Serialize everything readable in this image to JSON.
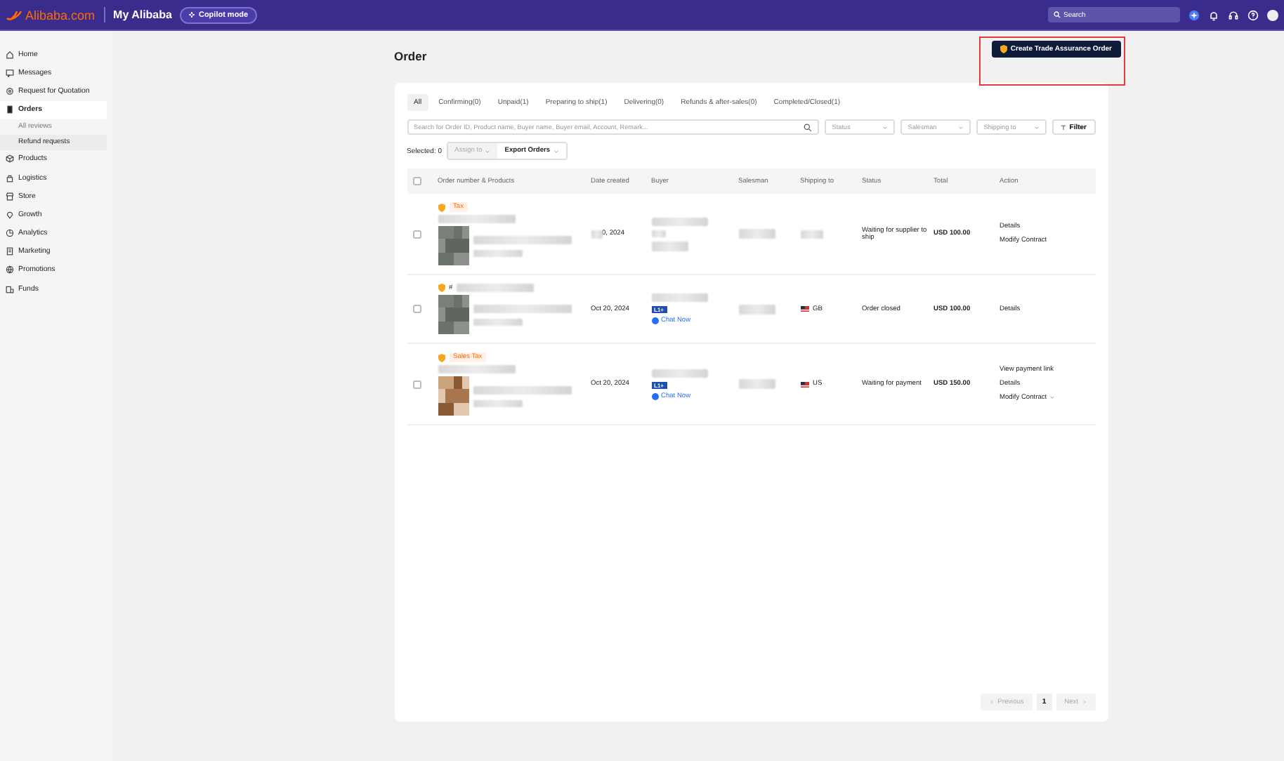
{
  "topbar": {
    "logo": "Alibaba.com",
    "title": "My Alibaba",
    "copilot": "Copilot mode",
    "search_placeholder": "Search"
  },
  "sidebar": {
    "items": [
      {
        "label": "Home",
        "selected": false
      },
      {
        "label": "Messages",
        "selected": false
      },
      {
        "label": "Request for Quotation",
        "selected": false
      },
      {
        "label": "Orders",
        "selected": true,
        "children": [
          {
            "label": "All reviews",
            "selected": false
          },
          {
            "label": "Refund requests",
            "selected": true
          }
        ]
      },
      {
        "label": "Products",
        "selected": false
      },
      {
        "label": "Logistics",
        "selected": false
      },
      {
        "label": "Store",
        "selected": false
      },
      {
        "label": "Growth",
        "selected": false
      },
      {
        "label": "Analytics",
        "selected": false
      },
      {
        "label": "Marketing",
        "selected": false
      },
      {
        "label": "Promotions",
        "selected": false
      },
      {
        "label": "Funds",
        "selected": false
      }
    ]
  },
  "page": {
    "title": "Order",
    "create_button": {
      "label": "Create Trade Assurance Order",
      "highlighted": true
    }
  },
  "tabs": [
    {
      "label": "All",
      "selected": true
    },
    {
      "label": "Confirming(0)",
      "selected": false
    },
    {
      "label": "Unpaid(1)",
      "selected": false
    },
    {
      "label": "Preparing to ship(1)",
      "selected": false
    },
    {
      "label": "Delivering(0)",
      "selected": false
    },
    {
      "label": "Refunds & after-sales(0)",
      "selected": false
    },
    {
      "label": "Completed/Closed(1)",
      "selected": false
    }
  ],
  "search": {
    "placeholder": "Search for Order ID, Product name, Buyer name, Buyer email, Account, Remark..."
  },
  "dropdowns": [
    "Status",
    "Salesman",
    "Shipping to"
  ],
  "filter_button": "Filter",
  "selection": {
    "label": "Selected: 0",
    "assign": {
      "label": "Assign to",
      "disabled": true
    },
    "export": "Export Orders"
  },
  "table": {
    "all_checked": false,
    "columns": [
      "Order number & Products",
      "Date created",
      "Buyer",
      "Salesman",
      "Shipping to",
      "Status",
      "Total",
      "Action"
    ],
    "rows": [
      {
        "checked": false,
        "tag": "Tax",
        "date": "0, 2024",
        "date_blurred": true,
        "status": "Waiting for supplier to ship",
        "total": "USD 100.00",
        "actions": [
          {
            "label": "Details",
            "caret": false
          },
          {
            "label": "Modify Contract",
            "caret": false
          }
        ]
      },
      {
        "checked": false,
        "order_number": "#",
        "date": "Oct 20, 2024",
        "date_blurred": false,
        "badge": "L1+",
        "chat": "Chat Now",
        "country": "GB",
        "status": "Order closed",
        "total": "USD 100.00",
        "actions": [
          {
            "label": "Details",
            "caret": false
          }
        ]
      },
      {
        "checked": false,
        "tag": "Sales Tax",
        "date": "Oct 20, 2024",
        "date_blurred": false,
        "badge": "L1+",
        "chat": "Chat Now",
        "country": "US",
        "status": "Waiting for payment",
        "total": "USD 150.00",
        "actions": [
          {
            "label": "View payment link",
            "caret": false
          },
          {
            "label": "Details",
            "caret": false
          },
          {
            "label": "Modify Contract",
            "caret": true
          }
        ]
      }
    ]
  },
  "pagination": {
    "previous": {
      "label": "Previous",
      "disabled": true
    },
    "pages": [
      {
        "label": "1",
        "selected": true
      }
    ],
    "next": {
      "label": "Next",
      "disabled": true
    }
  }
}
